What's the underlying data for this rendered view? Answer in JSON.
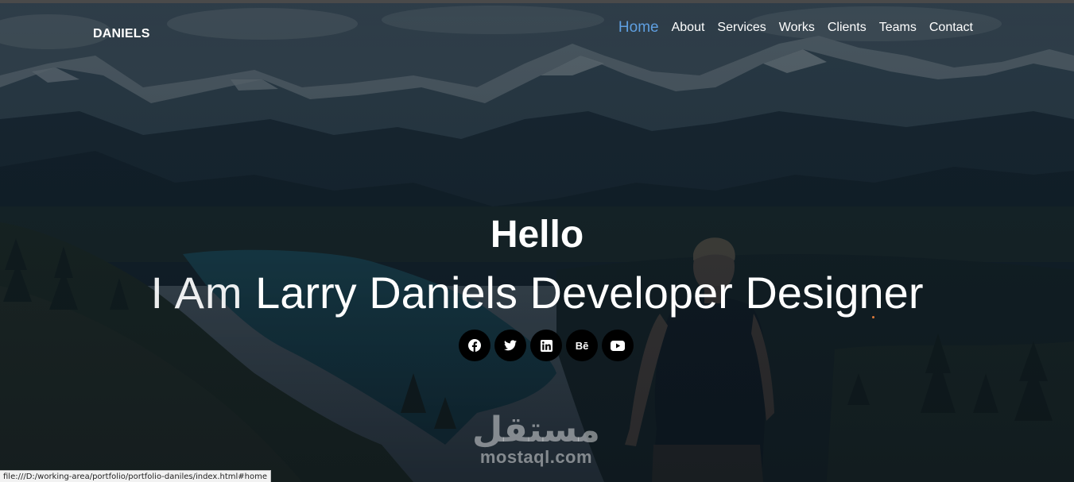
{
  "brand": "DANIELS",
  "nav": {
    "items": [
      {
        "label": "Home",
        "active": true
      },
      {
        "label": "About"
      },
      {
        "label": "Services"
      },
      {
        "label": "Works"
      },
      {
        "label": "Clients"
      },
      {
        "label": "Teams"
      },
      {
        "label": "Contact"
      }
    ],
    "active_color": "#5f9fe0"
  },
  "hero": {
    "greeting": "Hello",
    "intro": "I Am",
    "typed": "Larry Daniels Developer Designer"
  },
  "social": [
    {
      "icon": "facebook-icon"
    },
    {
      "icon": "twitter-icon"
    },
    {
      "icon": "linkedin-icon"
    },
    {
      "icon": "behance-icon",
      "label": "Bē"
    },
    {
      "icon": "youtube-icon"
    }
  ],
  "watermark": {
    "arabic": "مستقل",
    "latin": "mostaql.com"
  },
  "status_url": "file:///D:/working-area/portfolio/portfolio-daniles/index.html#home",
  "colors": {
    "overlay": "#0d1620",
    "icon_bg": "#000000"
  }
}
